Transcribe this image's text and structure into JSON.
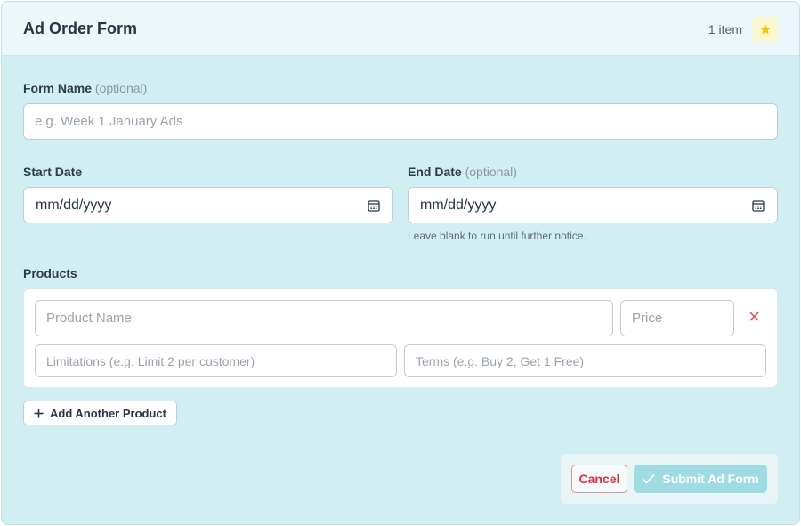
{
  "header": {
    "title": "Ad Order Form",
    "item_count": "1 item",
    "star_icon": "star-icon",
    "star_color": "#f2c500"
  },
  "form_name": {
    "label": "Form Name",
    "optional": "(optional)",
    "placeholder": "e.g. Week 1 January Ads",
    "value": ""
  },
  "start_date": {
    "label": "Start Date",
    "value": "mm/dd/yyyy",
    "icon": "calendar-icon"
  },
  "end_date": {
    "label": "End Date",
    "optional": "(optional)",
    "value": "mm/dd/yyyy",
    "icon": "calendar-icon",
    "helper": "Leave blank to run until further notice."
  },
  "products": {
    "label": "Products",
    "items": [
      {
        "name_placeholder": "Product Name",
        "price_placeholder": "Price",
        "limitations_placeholder": "Limitations (e.g. Limit 2 per customer)",
        "terms_placeholder": "Terms (e.g. Buy 2, Get 1 Free)"
      }
    ],
    "remove_icon": "close-icon",
    "remove_color": "#e05a5f",
    "add_label": "Add Another Product",
    "add_icon": "plus-icon"
  },
  "footer": {
    "cancel_label": "Cancel",
    "submit_label": "Submit Ad Form",
    "submit_icon": "check-icon",
    "cancel_color": "#d9343c",
    "submit_color": "#9fdbe3"
  }
}
